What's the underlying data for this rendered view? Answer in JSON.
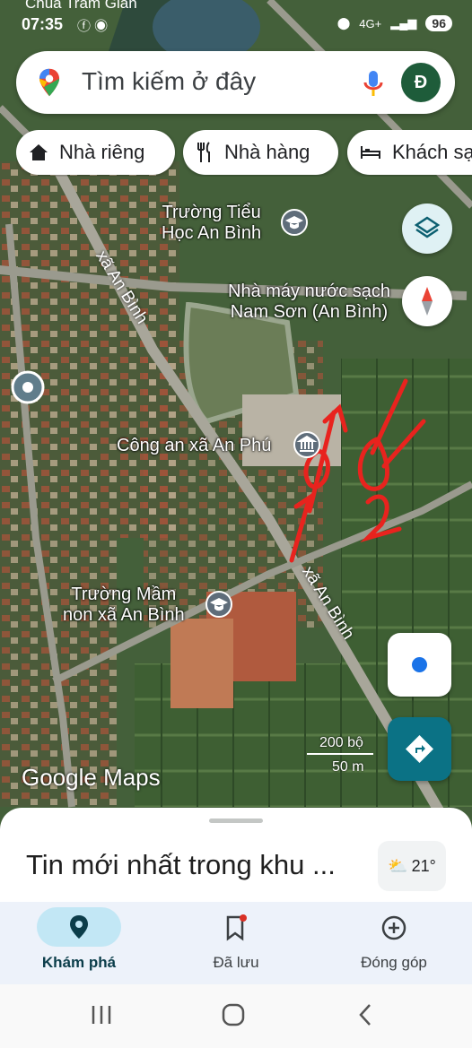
{
  "status": {
    "place": "Chùa Tràm Gian",
    "time": "07:35",
    "battery": "96",
    "network": "4G+"
  },
  "search": {
    "placeholder": "Tìm kiếm ở đây",
    "avatar_letter": "Đ"
  },
  "chips": [
    {
      "label": "Nhà riêng",
      "icon": "home-icon"
    },
    {
      "label": "Nhà hàng",
      "icon": "restaurant-icon"
    },
    {
      "label": "Khách sạn",
      "icon": "hotel-icon"
    }
  ],
  "map": {
    "places": [
      {
        "name": "Trường Tiểu Học An Bình",
        "line1": "Trường Tiểu",
        "line2": "Học An Bình",
        "icon": "school-icon"
      },
      {
        "name": "Nhà máy nước sạch Nam Sơn (An Bình)",
        "line1": "Nhà máy nước sạch",
        "line2": "Nam Sơn (An Bình)"
      },
      {
        "name": "Công an xã An Phú",
        "line1": "Công an xã An Phú",
        "icon": "government-icon"
      },
      {
        "name": "Trường Mầm non xã An Bình",
        "line1": "Trường Mầm",
        "line2": "non xã An Bình",
        "icon": "school-icon"
      }
    ],
    "roads": [
      "xã An Bình",
      "xã An Bình"
    ],
    "scale": {
      "imperial": "200 bộ",
      "metric": "50 m"
    },
    "attribution": "Google Maps",
    "handwritten_annotation": "98 / 2"
  },
  "sheet": {
    "title": "Tin mới nhất trong khu ...",
    "weather_temp": "21°"
  },
  "nav": [
    {
      "label": "Khám phá",
      "icon": "explore-pin-icon",
      "active": true
    },
    {
      "label": "Đã lưu",
      "icon": "bookmark-icon",
      "active": false
    },
    {
      "label": "Đóng góp",
      "icon": "add-circle-icon",
      "active": false
    }
  ],
  "colors": {
    "accent": "#1a73e8",
    "nav_active": "#c2e7f5",
    "annotation": "#e8231e",
    "directions": "#0b7285"
  }
}
